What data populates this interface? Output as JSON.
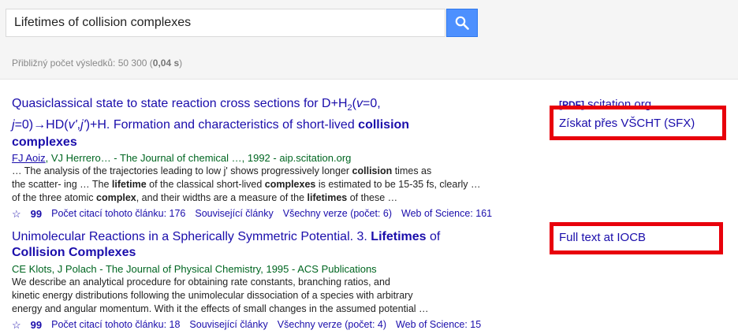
{
  "search": {
    "query": "Lifetimes of collision complexes"
  },
  "stats": {
    "prefix": "Přibližný počet výsledků: 50 300 (",
    "time": "0,04 s",
    "suffix": ")"
  },
  "results": [
    {
      "title_parts": [
        "Quasiclassical state to state reaction cross sections for D+H",
        "2",
        "(",
        "v",
        "=0,"
      ],
      "title_line2_parts": [
        "j",
        "=0)→HD(",
        "v'",
        ",",
        "j'",
        ")+H. Formation and characteristics of short-lived "
      ],
      "title_hl1": "collision",
      "title_hl2": "complexes",
      "author_link": "FJ Aoiz",
      "meta_rest": ", VJ Herrero… - The Journal of chemical …, 1992 - aip.scitation.org",
      "snippet": [
        [
          "… The analysis of the trajectories leading to low j' shows progressively longer ",
          "collision",
          " times as"
        ],
        [
          "the scatter- ing … The ",
          "lifetime",
          " of the classical short-lived ",
          "complexes",
          " is estimated to be 15-35 fs, clearly …"
        ],
        [
          "of the three atomic ",
          "complex",
          ", and their widths are a measure of the ",
          "lifetimes",
          " of these …"
        ]
      ],
      "links": [
        "Počet citací tohoto článku: 176",
        "Související články",
        "Všechny verze (počet: 6)",
        "Web of Science: 161"
      ],
      "side_pdf": "[PDF]",
      "side_pdf_source": " scitation.org",
      "side_link": "Získat přes VŠCHT (SFX)"
    },
    {
      "title_a": "Unimolecular Reactions in a Spherically Symmetric Potential. 3. ",
      "title_hl1": "Lifetimes",
      "title_b": " of",
      "title_hl2": "Collision Complexes",
      "meta": "CE Klots, J Polach - The Journal of Physical Chemistry, 1995 - ACS Publications",
      "snippet": [
        "We describe an analytical procedure for obtaining rate constants, branching ratios, and",
        "kinetic energy distributions following the unimolecular dissociation of a species with arbitrary",
        "energy and angular momentum. With it the effects of small changes in the assumed potential …"
      ],
      "links": [
        "Počet citací tohoto článku: 18",
        "Související články",
        "Všechny verze (počet: 4)",
        "Web of Science: 15"
      ],
      "side_link": "Full text at IOCB"
    }
  ],
  "icons": {
    "star": "star-icon",
    "quote": "quote-icon",
    "search": "search-icon"
  },
  "colors": {
    "link": "#1a0dab",
    "green": "#006621",
    "highlight_box": "#e8000b",
    "search_button": "#4d90fe"
  }
}
